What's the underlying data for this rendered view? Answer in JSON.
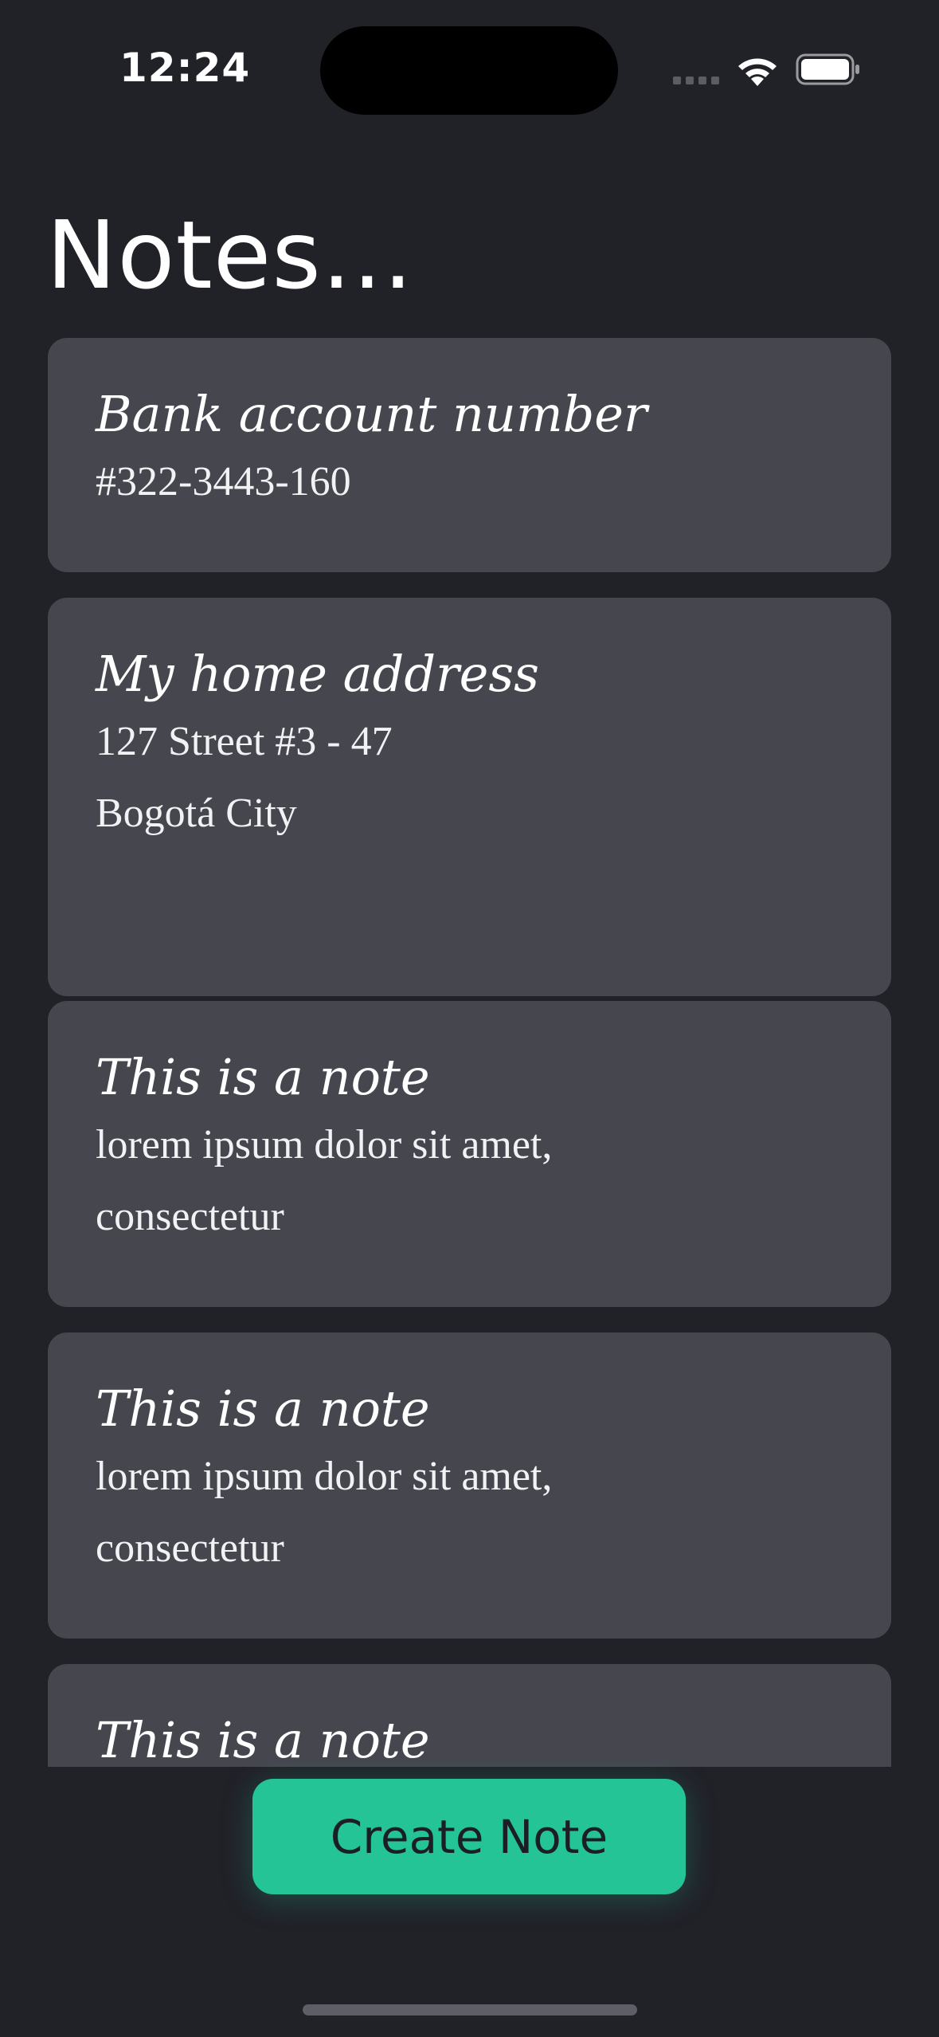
{
  "status_bar": {
    "time": "12:24",
    "signal_icon": "cellular-signal-icon",
    "wifi_icon": "wifi-icon",
    "battery_icon": "battery-icon"
  },
  "header": {
    "title": "Notes..."
  },
  "notes": [
    {
      "title": "Bank account number",
      "body": "#322-3443-160"
    },
    {
      "title": "My home address",
      "body": "127 Street #3 - 47\nBogotá City"
    },
    {
      "title": "This is a note",
      "body": "lorem ipsum dolor sit amet,\nconsectetur"
    },
    {
      "title": "This is a note",
      "body": "lorem ipsum dolor sit amet,\nconsectetur"
    },
    {
      "title": "This is a note",
      "body": ""
    }
  ],
  "actions": {
    "create_note_label": "Create Note"
  },
  "colors": {
    "background": "#212128",
    "card": "#46464f",
    "accent": "#24c497",
    "button_text": "#1b1f24"
  }
}
